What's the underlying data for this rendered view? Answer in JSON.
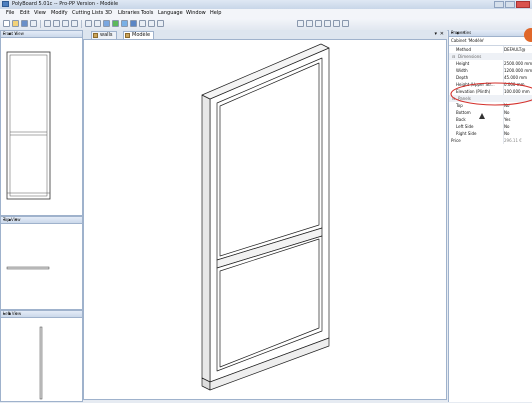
{
  "app": {
    "title": "PolyBoard 5.01c -- Pro-PP Version - Modèle"
  },
  "menus": [
    "File",
    "Edit",
    "View",
    "Modify",
    "Cutting Lists",
    "3D",
    "Libraries",
    "Tools",
    "Language",
    "Window",
    "Help"
  ],
  "panels": {
    "front": {
      "title": "Front View"
    },
    "top": {
      "title": "Top View"
    },
    "left": {
      "title": "Left View"
    },
    "panel_buttons": "▾ ▪ ✕"
  },
  "tabs": [
    {
      "label": "walls"
    },
    {
      "label": "Modèle"
    }
  ],
  "viewport_close": "✕",
  "viewport_pin": "▾",
  "properties": {
    "title": "Properties",
    "object": "Cabinet 'Modèle'",
    "rows": [
      {
        "key": "Method",
        "value": "DEFAULT@",
        "kind": "prop"
      },
      {
        "key": "Dimensions",
        "value": "",
        "kind": "group"
      },
      {
        "key": "Height",
        "value": "2500.000 mm",
        "kind": "prop"
      },
      {
        "key": "Width",
        "value": "1200.000 mm",
        "kind": "prop"
      },
      {
        "key": "Depth",
        "value": "45.000 mm",
        "kind": "prop"
      },
      {
        "key": "Height (Upper Str...",
        "value": "0.000 mm",
        "kind": "prop"
      },
      {
        "key": "Elevation (Plinth)",
        "value": "100.000 mm",
        "kind": "prop"
      },
      {
        "key": "Panels",
        "value": "",
        "kind": "group"
      },
      {
        "key": "Top",
        "value": "No",
        "kind": "prop"
      },
      {
        "key": "Bottom",
        "value": "No",
        "kind": "prop"
      },
      {
        "key": "Back",
        "value": "Yes",
        "kind": "prop"
      },
      {
        "key": "Left Side",
        "value": "No",
        "kind": "prop"
      },
      {
        "key": "Right Side",
        "value": "No",
        "kind": "prop"
      },
      {
        "key": "Price",
        "value": "296.11 €",
        "kind": "price"
      }
    ]
  },
  "colors": {
    "highlight_ellipse": "#d4302b",
    "accent_circle": "#e0672a"
  }
}
